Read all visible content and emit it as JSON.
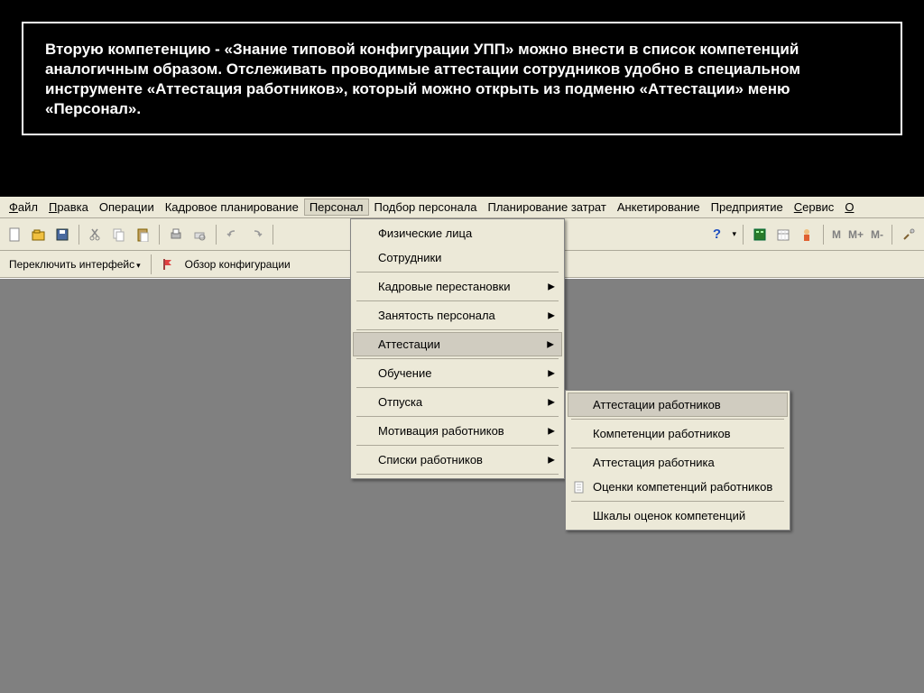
{
  "description": "Вторую компетенцию - «Знание типовой конфигурации УПП» можно внести в список компетенций аналогичным образом. Отслеживать проводимые аттестации сотрудников удобно в специальном инструменте «Аттестация работников», который можно открыть из подменю «Аттестации» меню «Персонал».",
  "menubar": {
    "file": "айл",
    "file_u": "Ф",
    "edit": "равка",
    "edit_u": "П",
    "ops": "Операции",
    "kadr": "Кадровое планирование",
    "personal": "Персонал",
    "podbor": "Подбор персонала",
    "plan": "Планирование затрат",
    "anket": "Анкетирование",
    "pred": "Предприятие",
    "service": "ервис",
    "service_u": "С",
    "win": "О"
  },
  "toolbar2": {
    "switch": "Переключить интерфейс",
    "overview": "Обзор конфигурации"
  },
  "tbtext": {
    "m": "M",
    "mplus": "M+",
    "mminus": "M-"
  },
  "menu_personal": {
    "fiz": "Физические лица",
    "sotr": "Сотрудники",
    "kadr": "Кадровые перестановки",
    "zan": "Занятость персонала",
    "att": "Аттестации",
    "obu": "Обучение",
    "otp": "Отпуска",
    "mot": "Мотивация работников",
    "spis": "Списки работников"
  },
  "submenu_att": {
    "att_rab": "Аттестации работников",
    "komp": "Компетенции работников",
    "att_rab2": "Аттестация работника",
    "ocenki": "Оценки компетенций работников",
    "shkaly": "Шкалы оценок компетенций"
  }
}
